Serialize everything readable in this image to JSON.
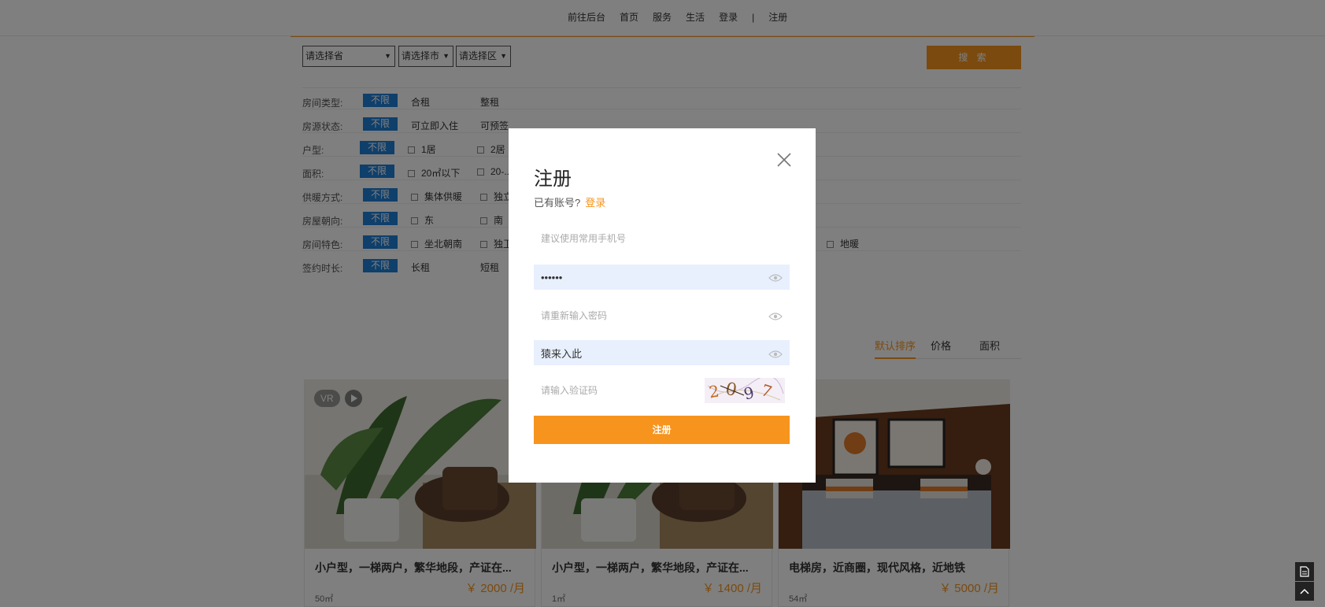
{
  "nav": {
    "items": [
      "前往后台",
      "首页",
      "服务",
      "生活",
      "登录"
    ],
    "separator": "|",
    "register": "注册"
  },
  "filters": {
    "province": "请选择省",
    "city": "请选择市",
    "district": "请选择区",
    "search_label": "搜 索",
    "any_label": "不限",
    "rows": [
      {
        "label": "房间类型:",
        "options": [
          "合租",
          "整租"
        ]
      },
      {
        "label": "房源状态:",
        "options": [
          "可立即入住",
          "可预签"
        ]
      },
      {
        "label": "户型:",
        "options": [
          "1居",
          "2居"
        ]
      },
      {
        "label": "面积:",
        "options": [
          "20㎡以下",
          "20-..."
        ]
      },
      {
        "label": "供暖方式:",
        "options": [
          "集体供暖",
          "独立"
        ]
      },
      {
        "label": "房屋朝向:",
        "options": [
          "东",
          "南"
        ]
      },
      {
        "label": "房间特色:",
        "options": [
          "坐北朝南",
          "独卫",
          "地暖"
        ]
      },
      {
        "label": "签约时长:",
        "options": [
          "长租",
          "短租"
        ]
      }
    ]
  },
  "sort": {
    "default": "默认排序",
    "price": "价格",
    "area": "面积"
  },
  "listings": [
    {
      "title": "小户型，一梯两户，繁华地段，产证在...",
      "price": "￥ 2000 /月",
      "area": "50㎡",
      "vr": "VR"
    },
    {
      "title": "小户型，一梯两户，繁华地段，产证在...",
      "price": "￥ 1400 /月",
      "area": "1㎡"
    },
    {
      "title": "电梯房，近商圈，现代风格，近地铁",
      "price": "￥ 5000 /月",
      "area": "54㎡"
    }
  ],
  "modal": {
    "title": "注册",
    "has_account": "已有账号?",
    "login_link": "登录",
    "phone_placeholder": "建议使用常用手机号",
    "password_value": "••••••",
    "confirm_placeholder": "请重新输入密码",
    "nickname_value": "猿来入此",
    "captcha_placeholder": "请输入验证码",
    "captcha_text": "2097",
    "submit_label": "注册"
  },
  "colors": {
    "accent": "#f7941d",
    "tag_blue": "#1e7fd6",
    "autofill": "#e8f0fe"
  }
}
